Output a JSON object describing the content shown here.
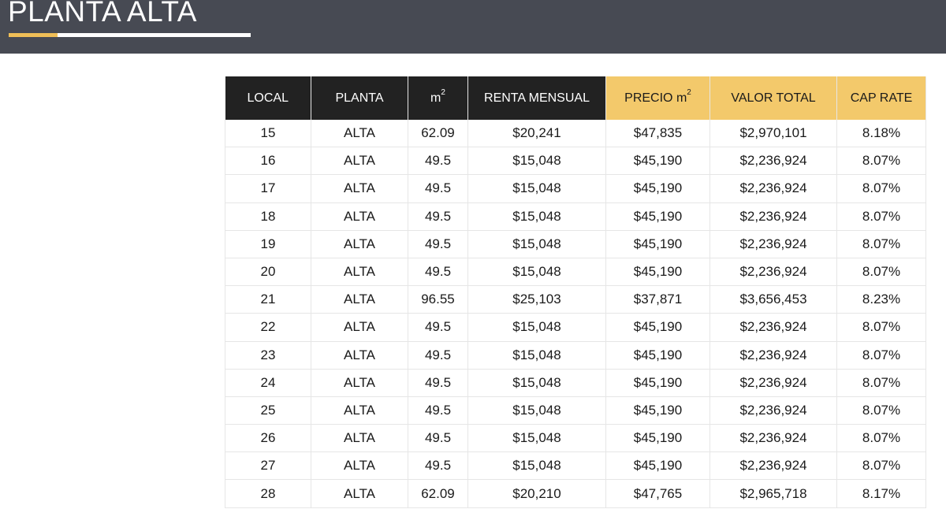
{
  "page": {
    "title": "PLANTA ALTA"
  },
  "table": {
    "headers": [
      {
        "key": "local",
        "label": "LOCAL",
        "sup": "",
        "style": "dark"
      },
      {
        "key": "planta",
        "label": "PLANTA",
        "sup": "",
        "style": "dark"
      },
      {
        "key": "m2",
        "label": "m",
        "sup": "2",
        "style": "dark"
      },
      {
        "key": "renta",
        "label": "RENTA MENSUAL",
        "sup": "",
        "style": "dark"
      },
      {
        "key": "precio",
        "label": "PRECIO m",
        "sup": "2",
        "style": "gold"
      },
      {
        "key": "valor",
        "label": "VALOR TOTAL",
        "sup": "",
        "style": "gold"
      },
      {
        "key": "cap",
        "label": "CAP RATE",
        "sup": "",
        "style": "gold"
      }
    ],
    "rows": [
      [
        "15",
        "ALTA",
        "62.09",
        "$20,241",
        "$47,835",
        "$2,970,101",
        "8.18%"
      ],
      [
        "16",
        "ALTA",
        "49.5",
        "$15,048",
        "$45,190",
        "$2,236,924",
        "8.07%"
      ],
      [
        "17",
        "ALTA",
        "49.5",
        "$15,048",
        "$45,190",
        "$2,236,924",
        "8.07%"
      ],
      [
        "18",
        "ALTA",
        "49.5",
        "$15,048",
        "$45,190",
        "$2,236,924",
        "8.07%"
      ],
      [
        "19",
        "ALTA",
        "49.5",
        "$15,048",
        "$45,190",
        "$2,236,924",
        "8.07%"
      ],
      [
        "20",
        "ALTA",
        "49.5",
        "$15,048",
        "$45,190",
        "$2,236,924",
        "8.07%"
      ],
      [
        "21",
        "ALTA",
        "96.55",
        "$25,103",
        "$37,871",
        "$3,656,453",
        "8.23%"
      ],
      [
        "22",
        "ALTA",
        "49.5",
        "$15,048",
        "$45,190",
        "$2,236,924",
        "8.07%"
      ],
      [
        "23",
        "ALTA",
        "49.5",
        "$15,048",
        "$45,190",
        "$2,236,924",
        "8.07%"
      ],
      [
        "24",
        "ALTA",
        "49.5",
        "$15,048",
        "$45,190",
        "$2,236,924",
        "8.07%"
      ],
      [
        "25",
        "ALTA",
        "49.5",
        "$15,048",
        "$45,190",
        "$2,236,924",
        "8.07%"
      ],
      [
        "26",
        "ALTA",
        "49.5",
        "$15,048",
        "$45,190",
        "$2,236,924",
        "8.07%"
      ],
      [
        "27",
        "ALTA",
        "49.5",
        "$15,048",
        "$45,190",
        "$2,236,924",
        "8.07%"
      ],
      [
        "28",
        "ALTA",
        "62.09",
        "$20,210",
        "$47,765",
        "$2,965,718",
        "8.17%"
      ]
    ]
  },
  "colors": {
    "banner": "#474a53",
    "accent": "#f0bf57",
    "header_dark": "#222222",
    "header_gold": "#f3c96b"
  }
}
